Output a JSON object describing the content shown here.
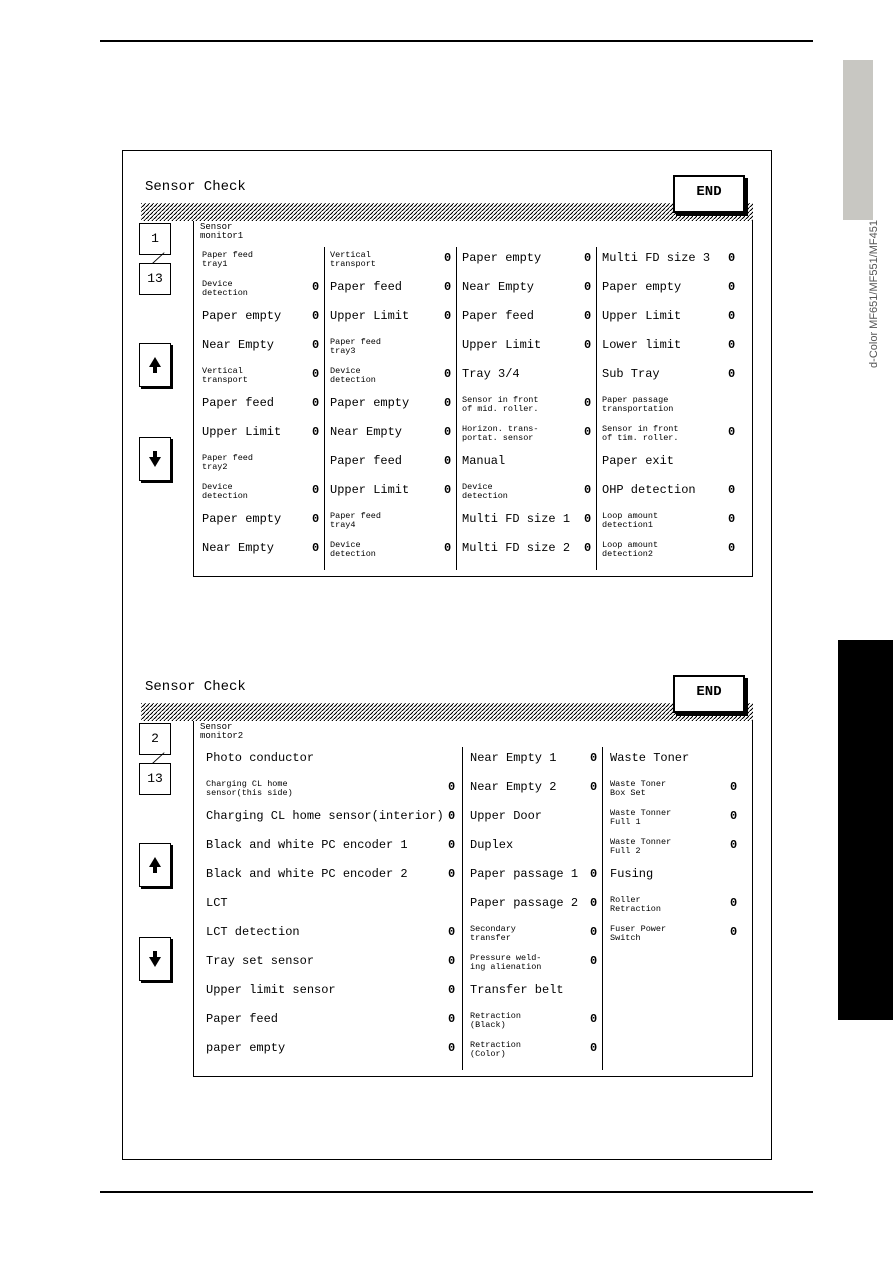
{
  "side_tab": "d-Color MF651/MF551/MF451",
  "end_label": "END",
  "pager": {
    "total": "13"
  },
  "panels": [
    {
      "title": "Sensor Check",
      "monitor_label": "Sensor\nmonitor1",
      "page_current": "1",
      "columns": [
        {
          "header": "Paper feed\ntray1",
          "header_small": true,
          "rows": [
            {
              "label": "Device\ndetection",
              "small": true,
              "val": "0"
            },
            {
              "label": "Paper empty",
              "val": "0"
            },
            {
              "label": "Near Empty",
              "val": "0"
            },
            {
              "label": "Vertical\ntransport",
              "small": true,
              "val": "0"
            },
            {
              "label": "Paper feed",
              "val": "0"
            },
            {
              "label": "Upper Limit",
              "val": "0"
            },
            {
              "label": "Paper feed\ntray2",
              "small": true,
              "header_like": true
            },
            {
              "label": "Device\ndetection",
              "small": true,
              "val": "0"
            },
            {
              "label": "Paper empty",
              "val": "0"
            },
            {
              "label": "Near Empty",
              "val": "0"
            }
          ]
        },
        {
          "header": "Vertical\ntransport",
          "header_small": true,
          "header_val": "0",
          "rows": [
            {
              "label": "Paper feed",
              "val": "0"
            },
            {
              "label": "Upper Limit",
              "val": "0"
            },
            {
              "label": "Paper feed\ntray3",
              "small": true,
              "header_like": true
            },
            {
              "label": "Device\ndetection",
              "small": true,
              "val": "0"
            },
            {
              "label": "Paper empty",
              "val": "0"
            },
            {
              "label": "Near Empty",
              "val": "0"
            },
            {
              "label": "Paper feed",
              "val": "0"
            },
            {
              "label": "Upper Limit",
              "val": "0"
            },
            {
              "label": "Paper feed\ntray4",
              "small": true,
              "header_like": true
            },
            {
              "label": "Device\ndetection",
              "small": true,
              "val": "0"
            }
          ]
        },
        {
          "header": "Paper empty",
          "header_val": "0",
          "rows": [
            {
              "label": "Near Empty",
              "val": "0"
            },
            {
              "label": "Paper feed",
              "val": "0"
            },
            {
              "label": "Upper Limit",
              "val": "0"
            },
            {
              "label": "Tray 3/4",
              "header_like": true
            },
            {
              "label": "Sensor in front\nof mid. roller.",
              "small": true,
              "val": "0"
            },
            {
              "label": "Horizon. trans-\nportat. sensor",
              "small": true,
              "val": "0"
            },
            {
              "label": "Manual",
              "header_like": true
            },
            {
              "label": "Device\ndetection",
              "small": true,
              "val": "0"
            },
            {
              "label": "Multi FD size 1",
              "val": "0"
            },
            {
              "label": "Multi FD size 2",
              "val": "0"
            }
          ]
        },
        {
          "header": "Multi FD size 3",
          "header_val": "0",
          "rows": [
            {
              "label": "Paper empty",
              "val": "0"
            },
            {
              "label": "Upper Limit",
              "val": "0"
            },
            {
              "label": "Lower limit",
              "val": "0"
            },
            {
              "label": "Sub Tray",
              "val": "0"
            },
            {
              "label": "Paper passage\ntransportation",
              "small": true,
              "header_like": true
            },
            {
              "label": "Sensor in front\nof tim. roller.",
              "small": true,
              "val": "0"
            },
            {
              "label": "Paper exit",
              "header_like": true
            },
            {
              "label": "OHP detection",
              "val": "0"
            },
            {
              "label": "Loop amount\ndetection1",
              "small": true,
              "val": "0"
            },
            {
              "label": "Loop amount\ndetection2",
              "small": true,
              "val": "0"
            }
          ]
        }
      ]
    },
    {
      "title": "Sensor Check",
      "monitor_label": "Sensor\nmonitor2",
      "page_current": "2",
      "columns": [
        {
          "header": "Photo conductor",
          "header_like": true,
          "rows": [
            {
              "label": "Charging CL home\nsensor(this side)",
              "small": true,
              "val": "0"
            },
            {
              "label": "Charging CL home sensor(interior)",
              "val": "0"
            },
            {
              "label": "Black and white PC encoder 1",
              "val": "0"
            },
            {
              "label": "Black and white PC encoder 2",
              "val": "0"
            },
            {
              "label": "LCT",
              "header_like": true
            },
            {
              "label": "LCT detection",
              "val": "0"
            },
            {
              "label": "Tray set sensor",
              "val": "0"
            },
            {
              "label": "Upper limit sensor",
              "val": "0"
            },
            {
              "label": "Paper feed",
              "val": "0"
            },
            {
              "label": "paper empty",
              "val": "0"
            }
          ]
        },
        {
          "header": "Near Empty 1",
          "header_val": "0",
          "rows": [
            {
              "label": "Near Empty 2",
              "val": "0"
            },
            {
              "label": "Upper Door",
              "header_like": true
            },
            {
              "label": "Duplex",
              "header_like": true
            },
            {
              "label": "Paper passage 1",
              "val": "0"
            },
            {
              "label": "Paper passage 2",
              "val": "0"
            },
            {
              "label": "Secondary\ntransfer",
              "small": true,
              "val": "0"
            },
            {
              "label": "Pressure weld-\ning alienation",
              "small": true,
              "val": "0"
            },
            {
              "label": "Transfer belt",
              "header_like": true
            },
            {
              "label": "Retraction\n(Black)",
              "small": true,
              "val": "0"
            },
            {
              "label": "Retraction\n(Color)",
              "small": true,
              "val": "0"
            }
          ]
        },
        {
          "header": "Waste Toner",
          "header_like": true,
          "rows": [
            {
              "label": "Waste Toner\nBox Set",
              "small": true,
              "val": "0"
            },
            {
              "label": "Waste Tonner\nFull 1",
              "small": true,
              "val": "0"
            },
            {
              "label": "Waste Tonner\nFull 2",
              "small": true,
              "val": "0"
            },
            {
              "label": "Fusing",
              "header_like": true
            },
            {
              "label": "Roller\nRetraction",
              "small": true,
              "val": "0"
            },
            {
              "label": "Fuser Power\nSwitch",
              "small": true,
              "val": "0"
            }
          ]
        }
      ]
    }
  ]
}
